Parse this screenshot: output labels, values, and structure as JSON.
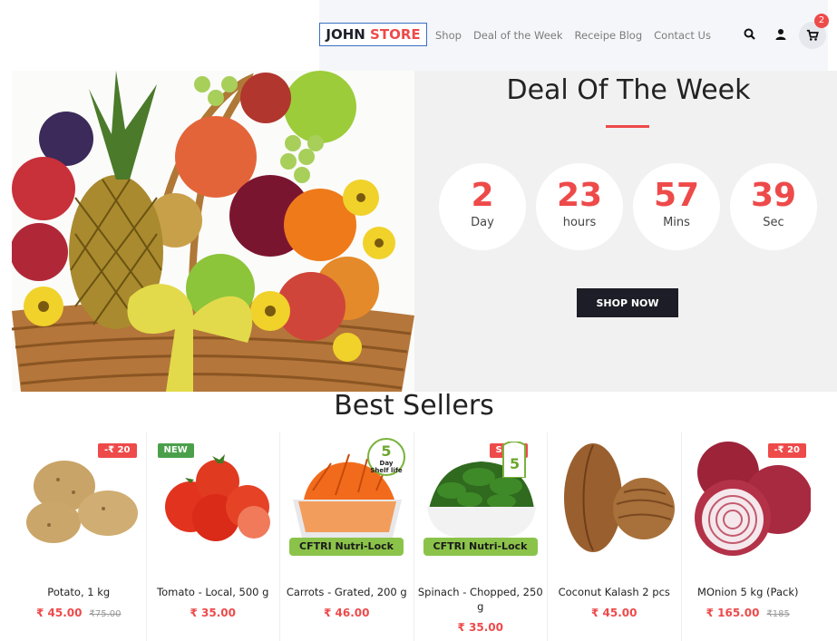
{
  "header": {
    "logo_part1": "JOHN",
    "logo_part2": "STORE",
    "nav": [
      "Shop",
      "Deal of the Week",
      "Receipe Blog",
      "Contact Us"
    ],
    "cart_count": "2"
  },
  "deal": {
    "title": "Deal Of The Week",
    "countdown": [
      {
        "value": "2",
        "unit": "Day"
      },
      {
        "value": "23",
        "unit": "hours"
      },
      {
        "value": "57",
        "unit": "Mins"
      },
      {
        "value": "39",
        "unit": "Sec"
      }
    ],
    "button": "SHOP NOW"
  },
  "best_sellers": {
    "title": "Best Sellers",
    "products": [
      {
        "name": "Potato, 1 kg",
        "price": "₹ 45.00",
        "old_price": "₹75.00",
        "tag": "-₹ 20"
      },
      {
        "name": "Tomato - Local, 500 g",
        "price": "₹ 35.00",
        "old_price": "",
        "tag": "NEW"
      },
      {
        "name": "Carrots - Grated, 200 g",
        "price": "₹ 46.00",
        "old_price": "",
        "tag": "",
        "banner": "CFTRI Nutri-Lock",
        "shelf_days": "5",
        "shelf_label_1": "Day",
        "shelf_label_2": "Shelf",
        "shelf_label_3": "life"
      },
      {
        "name": "Spinach - Chopped, 250 g",
        "price": "₹ 35.00",
        "old_price": "",
        "tag": "SALE",
        "banner": "CFTRI Nutri-Lock"
      },
      {
        "name": "Coconut Kalash 2 pcs",
        "price": "₹ 45.00",
        "old_price": "",
        "tag": ""
      },
      {
        "name": "MOnion 5 kg (Pack)",
        "price": "₹ 165.00",
        "old_price": "₹185",
        "tag": "-₹ 20"
      }
    ]
  },
  "colors": {
    "accent": "#ee4a4a",
    "dark": "#1c1d26",
    "green": "#8bc34a"
  }
}
